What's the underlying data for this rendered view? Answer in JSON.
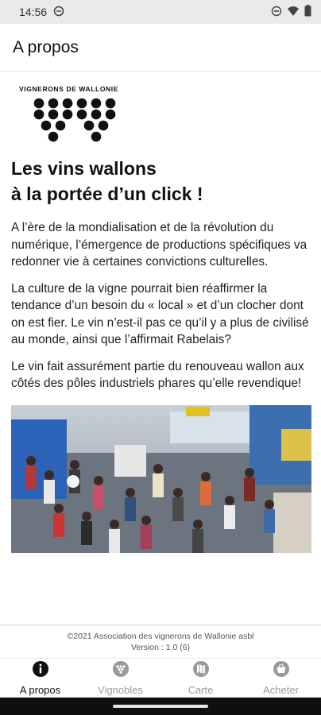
{
  "status_bar": {
    "time": "14:56",
    "icons": [
      "data-saver-icon",
      "do-not-disturb-icon",
      "wifi-icon",
      "battery-icon"
    ]
  },
  "app_bar": {
    "title": "A propos"
  },
  "logo": {
    "text": "VIGNERONS DE WALLONIE"
  },
  "main": {
    "headline_line1": "Les vins wallons",
    "headline_line2": "à la portée d’un click !",
    "paragraphs": [
      "A l’ère de la mondialisation et de la révolution du numérique, l’émergence de productions spécifiques va redonner vie à certaines convictions culturelles.",
      "La culture de la vigne pourrait bien réaffirmer la tendance d’un besoin du « local »  et d’un clocher dont on est fier. Le vin n’est-il pas ce qu’il y a plus de civilisé au monde, ainsi que l’affirmait Rabelais?",
      "Le vin fait assurément partie du renouveau wallon aux côtés des pôles industriels phares qu’elle revendique!"
    ],
    "photo": "crowd-at-wine-fair-photo"
  },
  "footer": {
    "copyright": "©2021 Association des vignerons de Wallonie asbl",
    "version": "Version : 1.0 (6)"
  },
  "bottom_nav": {
    "items": [
      {
        "label": "A propos",
        "icon": "info-icon",
        "active": true
      },
      {
        "label": "Vignobles",
        "icon": "vineyard-icon",
        "active": false
      },
      {
        "label": "Carte",
        "icon": "map-icon",
        "active": false
      },
      {
        "label": "Acheter",
        "icon": "basket-icon",
        "active": false
      }
    ]
  },
  "colors": {
    "active": "#111111",
    "inactive": "#9a9a9a",
    "status_bar_bg": "#eaeaea",
    "gesture_bar_bg": "#0f0f0f"
  }
}
